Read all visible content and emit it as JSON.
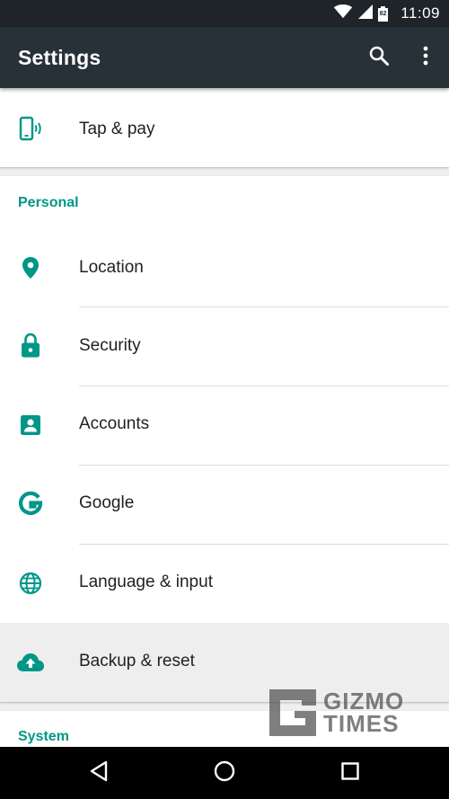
{
  "status_bar": {
    "time": "11:09",
    "battery_level": "82"
  },
  "app_bar": {
    "title": "Settings",
    "search_icon": "search-icon",
    "more_icon": "more-vert-icon"
  },
  "sections": [
    {
      "header": "",
      "items": [
        {
          "label": "Tap & pay",
          "icon": "tap-and-pay-icon"
        }
      ]
    },
    {
      "header": "Personal",
      "items": [
        {
          "label": "Location",
          "icon": "location-icon"
        },
        {
          "label": "Security",
          "icon": "lock-icon"
        },
        {
          "label": "Accounts",
          "icon": "account-box-icon"
        },
        {
          "label": "Google",
          "icon": "google-icon"
        },
        {
          "label": "Language & input",
          "icon": "globe-icon"
        },
        {
          "label": "Backup & reset",
          "icon": "cloud-upload-icon",
          "selected": true
        }
      ]
    },
    {
      "header": "System",
      "items": []
    }
  ],
  "watermark": {
    "line1": "GIZMO",
    "line2": "TIMES"
  },
  "colors": {
    "accent": "#009688",
    "app_bar": "#263238",
    "status_bar": "#1e2428"
  }
}
